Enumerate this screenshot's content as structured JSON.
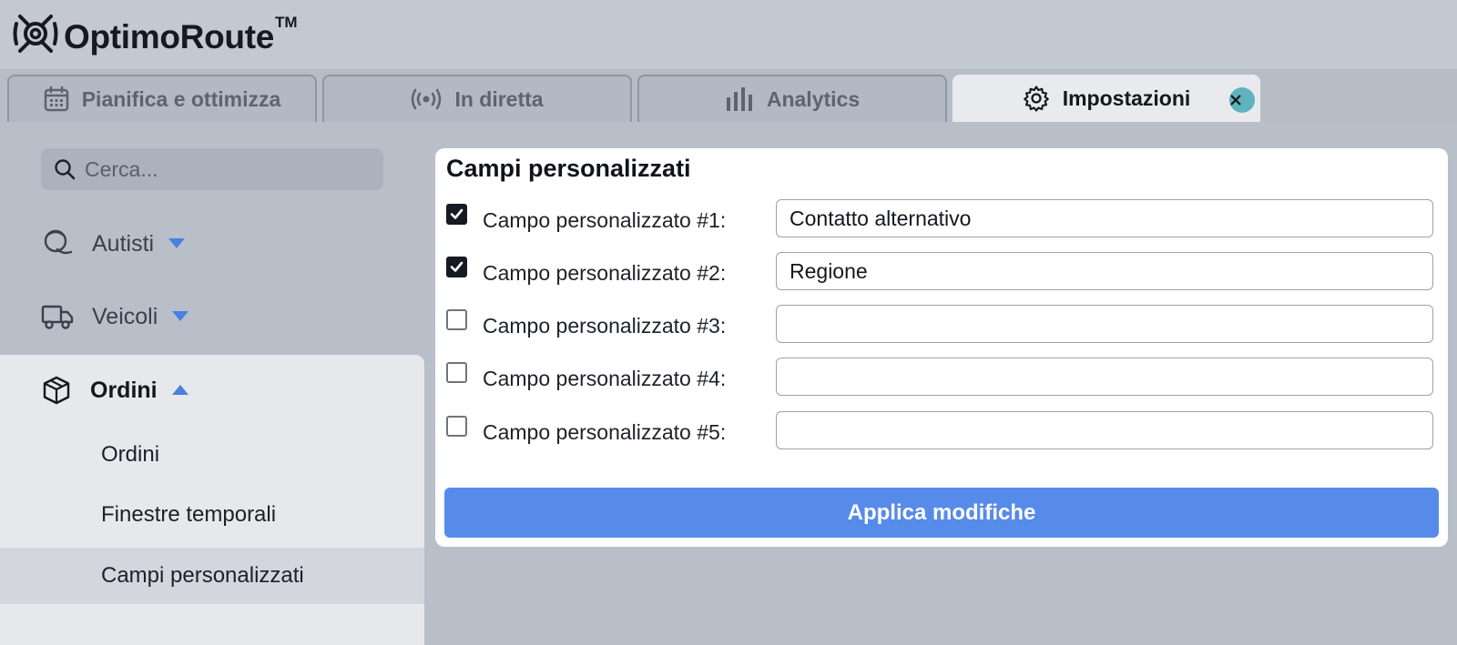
{
  "app": {
    "brand": "OptimoRoute",
    "trademark": "TM"
  },
  "tabs": [
    {
      "label": "Pianifica e ottimizza",
      "icon": "calendar-icon"
    },
    {
      "label": "In diretta",
      "icon": "broadcast-icon"
    },
    {
      "label": "Analytics",
      "icon": "bar-chart-icon"
    },
    {
      "label": "Impostazioni",
      "icon": "gear-icon",
      "active": true
    }
  ],
  "sidebar": {
    "search_placeholder": "Cerca...",
    "items": [
      {
        "label": "Autisti",
        "icon": "driver-icon",
        "expanded": false
      },
      {
        "label": "Veicoli",
        "icon": "truck-icon",
        "expanded": false
      },
      {
        "label": "Ordini",
        "icon": "box-icon",
        "expanded": true
      }
    ],
    "sub_items": [
      "Ordini",
      "Finestre temporali",
      "Campi personalizzati"
    ],
    "active_sub_item": "Campi personalizzati"
  },
  "main": {
    "title": "Campi personalizzati",
    "fields": [
      {
        "label": "Campo personalizzato #1:",
        "checked": true,
        "value": "Contatto alternativo"
      },
      {
        "label": "Campo personalizzato #2:",
        "checked": true,
        "value": "Regione"
      },
      {
        "label": "Campo personalizzato #3:",
        "checked": false,
        "value": ""
      },
      {
        "label": "Campo personalizzato #4:",
        "checked": false,
        "value": ""
      },
      {
        "label": "Campo personalizzato #5:",
        "checked": false,
        "value": ""
      }
    ],
    "apply_label": "Applica modifiche"
  },
  "colors": {
    "accent": "#578bea",
    "close_button": "#5fb3bf",
    "background": "#b9bfc9"
  }
}
